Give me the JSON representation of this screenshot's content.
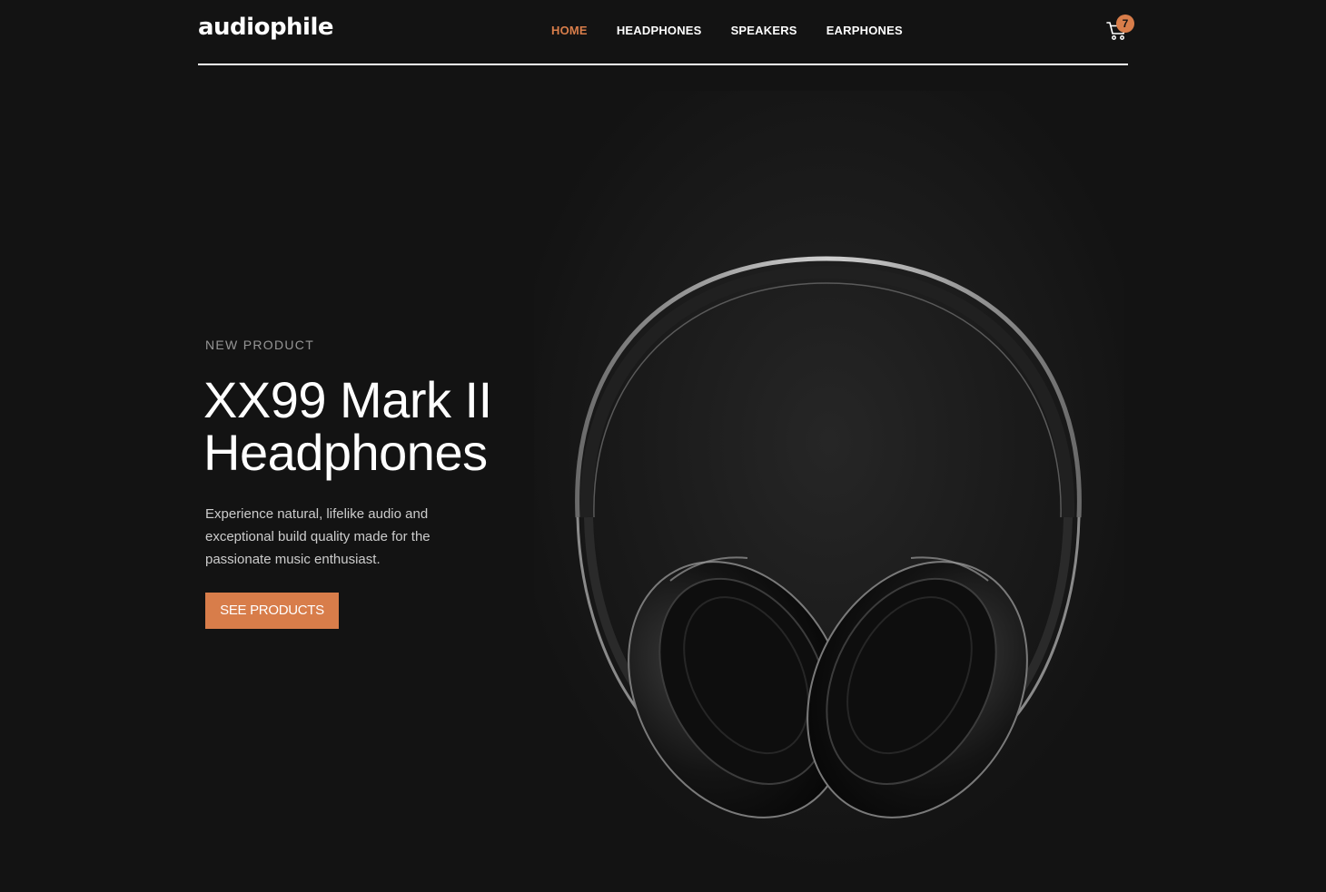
{
  "brand": {
    "logo_text": "audiophile",
    "accent_color": "#d87d4a",
    "background_color": "#131313"
  },
  "nav": {
    "items": [
      {
        "label": "HOME",
        "active": true
      },
      {
        "label": "HEADPHONES",
        "active": false
      },
      {
        "label": "SPEAKERS",
        "active": false
      },
      {
        "label": "EARPHONES",
        "active": false
      }
    ]
  },
  "cart": {
    "icon": "cart-icon",
    "count": "7"
  },
  "hero": {
    "overline": "NEW PRODUCT",
    "title_line1": "XX99 Mark II",
    "title_line2": "Headphones",
    "description": "Experience natural, lifelike audio and exceptional build quality made for the passionate music enthusiast.",
    "cta_label": "SEE PRODUCTS",
    "image": "headphones-image"
  }
}
